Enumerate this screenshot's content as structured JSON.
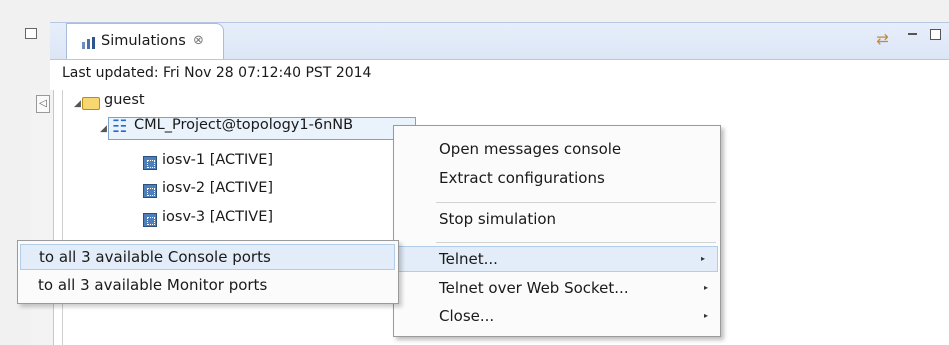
{
  "view": {
    "tab_title": "Simulations",
    "tab_close_glyph": "⊗",
    "sync_glyph": "⇄",
    "collapse_glyph": "◁"
  },
  "status": {
    "last_updated": "Last updated: Fri Nov 28 07:12:40 PST 2014"
  },
  "tree": {
    "twisty_glyph": "◢",
    "folder_label": "guest",
    "project_label": "CML_Project@topology1-6nNB",
    "project_icon": "☷",
    "nodes": [
      {
        "label": "iosv-1  [ACTIVE]"
      },
      {
        "label": "iosv-2  [ACTIVE]"
      },
      {
        "label": "iosv-3  [ACTIVE]"
      }
    ]
  },
  "context_menu": {
    "submenu_arrow": "▸",
    "items": [
      {
        "label": "Open messages console"
      },
      {
        "label": "Extract configurations"
      },
      {
        "label": "Stop simulation"
      },
      {
        "label": "Telnet..."
      },
      {
        "label": "Telnet over Web Socket..."
      },
      {
        "label": "Close..."
      }
    ]
  },
  "submenu": {
    "items": [
      {
        "label": "to all 3 available Console ports"
      },
      {
        "label": "to all 3 available Monitor ports"
      }
    ]
  }
}
